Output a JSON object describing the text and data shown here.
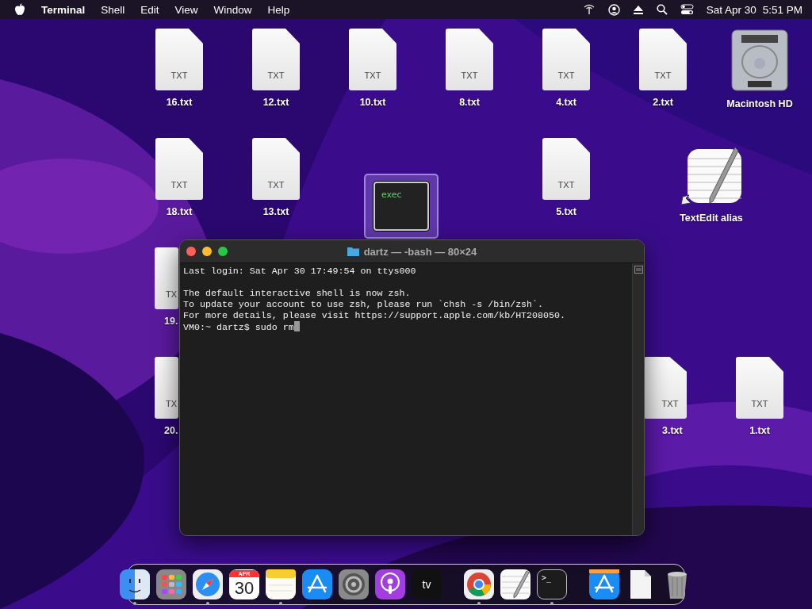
{
  "menu_bar": {
    "app_name": "Terminal",
    "menus": [
      "Shell",
      "Edit",
      "View",
      "Window",
      "Help"
    ],
    "date": "Sat Apr 30",
    "time": "5:51 PM"
  },
  "desktop": {
    "items": [
      {
        "kind": "file",
        "badge": "TXT",
        "label": "16.txt",
        "selected": false
      },
      {
        "kind": "file",
        "badge": "TXT",
        "label": "12.txt",
        "selected": false
      },
      {
        "kind": "file",
        "badge": "TXT",
        "label": "10.txt",
        "selected": false
      },
      {
        "kind": "file",
        "badge": "TXT",
        "label": "8.txt",
        "selected": false
      },
      {
        "kind": "file",
        "badge": "TXT",
        "label": "4.txt",
        "selected": false
      },
      {
        "kind": "file",
        "badge": "TXT",
        "label": "2.txt",
        "selected": false
      },
      {
        "kind": "drive",
        "label": "Macintosh HD",
        "selected": false
      },
      {
        "kind": "file",
        "badge": "TXT",
        "label": "18.txt",
        "selected": false
      },
      {
        "kind": "file",
        "badge": "TXT",
        "label": "13.txt",
        "selected": false
      },
      {
        "kind": "exec",
        "badge": "exec",
        "selected": true
      },
      {
        "kind": "file",
        "badge": "TXT",
        "label": "5.txt",
        "selected": false
      },
      {
        "kind": "alias",
        "label": "TextEdit alias",
        "selected": false
      },
      {
        "kind": "file",
        "badge": "TX",
        "label": "19.",
        "selected": false,
        "covered_right": true
      },
      {
        "kind": "file",
        "badge": "TX",
        "label": "20.",
        "selected": false,
        "covered_right": true
      },
      {
        "kind": "file",
        "badge": "TXT",
        "label": "3.txt",
        "selected": false,
        "covered_left": true
      },
      {
        "kind": "file",
        "badge": "TXT",
        "label": "1.txt",
        "selected": false
      }
    ]
  },
  "terminal": {
    "title": "dartz — -bash — 80×24",
    "blocks": [
      [
        "Last login: Sat Apr 30 17:49:54 on ttys000"
      ],
      [
        "The default interactive shell is now zsh.",
        "To update your account to use zsh, please run `chsh -s /bin/zsh`.",
        "For more details, please visit https://support.apple.com/kb/HT208050."
      ]
    ],
    "prompt": "VM0:~ dartz$ sudo rm"
  },
  "dock": {
    "items": [
      {
        "kind": "finder",
        "running": true
      },
      {
        "kind": "launchpad",
        "running": false
      },
      {
        "kind": "safari",
        "running": true
      },
      {
        "kind": "calendar",
        "month": "APR",
        "day": "30",
        "running": false
      },
      {
        "kind": "notes",
        "running": true
      },
      {
        "kind": "appstore",
        "running": false
      },
      {
        "kind": "settings",
        "running": false
      },
      {
        "kind": "podcasts",
        "running": false
      },
      {
        "kind": "tv",
        "text": "tv",
        "running": false
      },
      {
        "kind": "separator"
      },
      {
        "kind": "chrome",
        "running": true
      },
      {
        "kind": "textedit",
        "running": false
      },
      {
        "kind": "terminal",
        "text": ">_",
        "running": true
      },
      {
        "kind": "separator"
      },
      {
        "kind": "downloads",
        "running": false
      },
      {
        "kind": "document",
        "running": false
      },
      {
        "kind": "trash",
        "running": false
      }
    ]
  }
}
